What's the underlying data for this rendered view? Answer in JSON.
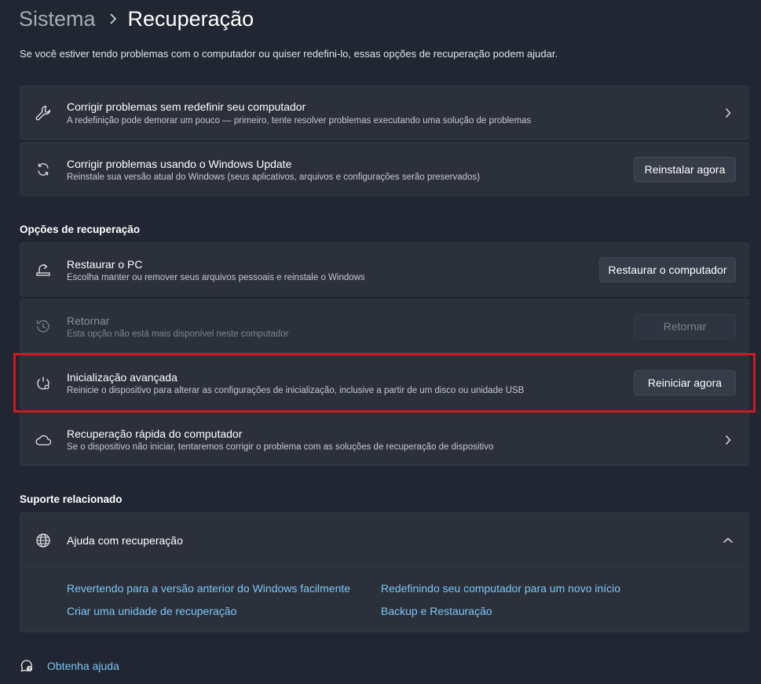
{
  "breadcrumb": {
    "parent": "Sistema",
    "current": "Recuperação"
  },
  "description": "Se você estiver tendo problemas com o computador ou quiser redefini-lo, essas opções de recuperação podem ajudar.",
  "cards": {
    "fix_without_reset": {
      "title": "Corrigir problemas sem redefinir seu computador",
      "subtitle": "A redefinição pode demorar um pouco — primeiro, tente resolver problemas executando uma solução de problemas",
      "icon": "wrench-icon"
    },
    "windows_update": {
      "title": "Corrigir problemas usando o Windows Update",
      "subtitle": "Reinstale sua versão atual do Windows (seus aplicativos, arquivos e configurações serão preservados)",
      "button": "Reinstalar agora",
      "icon": "sync-icon"
    }
  },
  "recovery_options": {
    "heading": "Opções de recuperação",
    "reset_pc": {
      "title": "Restaurar o PC",
      "subtitle": "Escolha manter ou remover seus arquivos pessoais e reinstale o Windows",
      "button": "Restaurar o computador",
      "icon": "reset-pc-icon"
    },
    "go_back": {
      "title": "Retornar",
      "subtitle": "Esta opção não está mais disponível neste computador",
      "button": "Retornar",
      "icon": "history-icon",
      "disabled": true
    },
    "advanced_startup": {
      "title": "Inicialização avançada",
      "subtitle": "Reinicie o dispositivo para alterar as configurações de inicialização, inclusive a partir de um disco ou unidade USB",
      "button": "Reiniciar agora",
      "icon": "advanced-startup-icon"
    },
    "quick_recovery": {
      "title": "Recuperação rápida do computador",
      "subtitle": "Se o dispositivo não iniciar, tentaremos corrigir o problema com as soluções de recuperação de dispositivo",
      "icon": "cloud-icon"
    }
  },
  "related_support": {
    "heading": "Suporte relacionado",
    "help_title": "Ajuda com recuperação",
    "icon": "globe-icon",
    "links": [
      "Revertendo para a versão anterior do Windows facilmente",
      "Redefinindo seu computador para um novo início",
      "Criar uma unidade de recuperação",
      "Backup e Restauração"
    ]
  },
  "footer": {
    "get_help": "Obtenha ajuda",
    "icon": "help-chat-icon"
  },
  "colors": {
    "background": "#202632",
    "card": "#2b303b",
    "link": "#7cc6f4",
    "highlight": "#d0191e"
  }
}
